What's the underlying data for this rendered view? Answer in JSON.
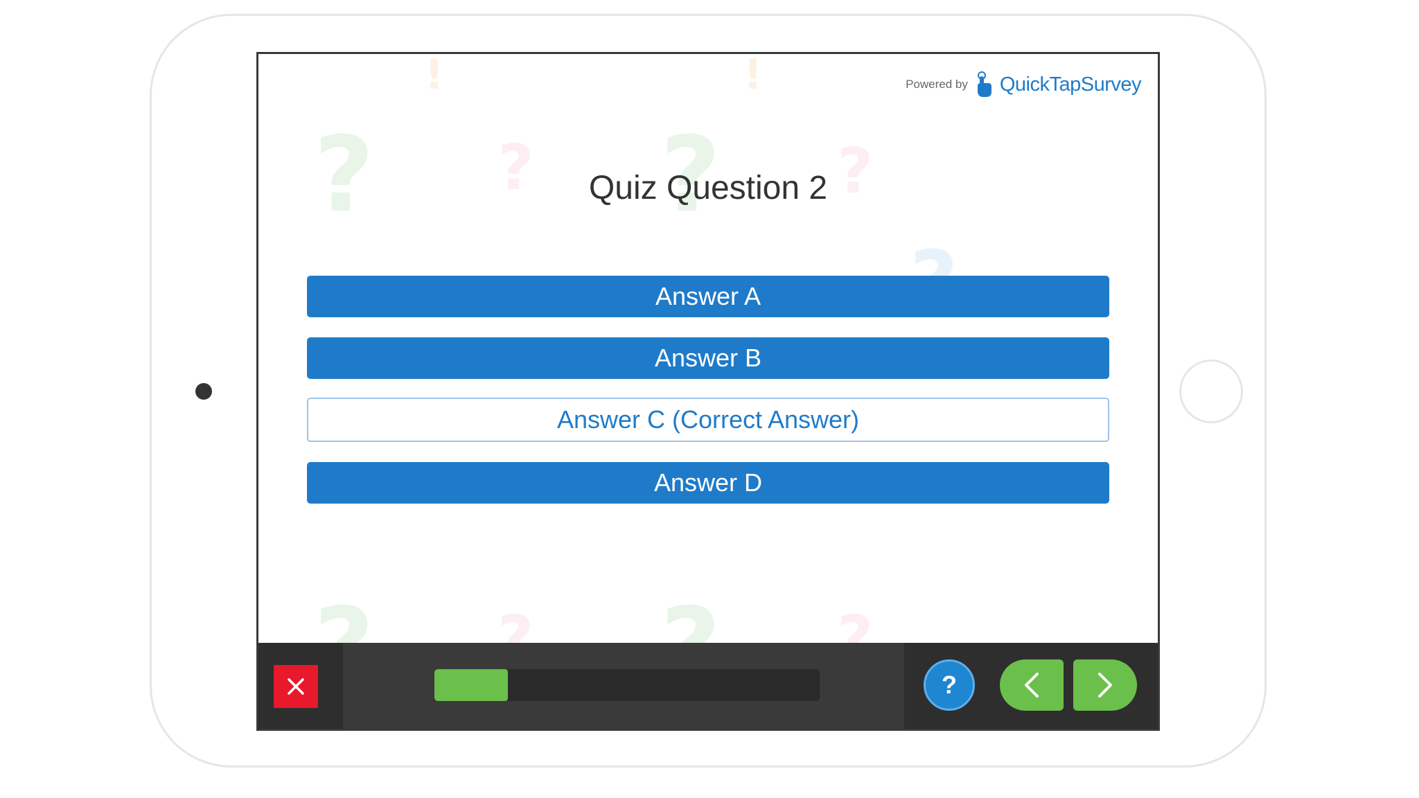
{
  "powered_by": {
    "label": "Powered by",
    "brand": "QuickTapSurvey"
  },
  "question": {
    "title": "Quiz Question 2"
  },
  "answers": [
    {
      "label": "Answer A",
      "style": "filled"
    },
    {
      "label": "Answer B",
      "style": "filled"
    },
    {
      "label": "Answer C (Correct Answer)",
      "style": "outline"
    },
    {
      "label": "Answer D",
      "style": "filled"
    }
  ],
  "footer": {
    "close_icon": "close-icon",
    "progress": 0.19,
    "help_glyph": "?",
    "prev_icon": "chevron-left-icon",
    "next_icon": "chevron-right-icon"
  },
  "colors": {
    "primary_blue": "#1f7bc9",
    "progress_green": "#6bc04b",
    "close_red": "#e8192c",
    "footer_dark": "#3a3a3a"
  },
  "background_marks": [
    {
      "glyph": "?",
      "color": "#e8f5e8"
    },
    {
      "glyph": "?",
      "color": "#fdeef3"
    },
    {
      "glyph": "?",
      "color": "#e8f5e8"
    },
    {
      "glyph": "?",
      "color": "#fdeef3"
    },
    {
      "glyph": "?",
      "color": "#e8f2fa"
    },
    {
      "glyph": "!",
      "color": "#fdf1e4"
    },
    {
      "glyph": "!",
      "color": "#fdf1e4"
    },
    {
      "glyph": "?",
      "color": "#e8f5e8"
    },
    {
      "glyph": "?",
      "color": "#fdeef3"
    },
    {
      "glyph": "?",
      "color": "#e8f5e8"
    },
    {
      "glyph": "?",
      "color": "#fdeef3"
    }
  ]
}
